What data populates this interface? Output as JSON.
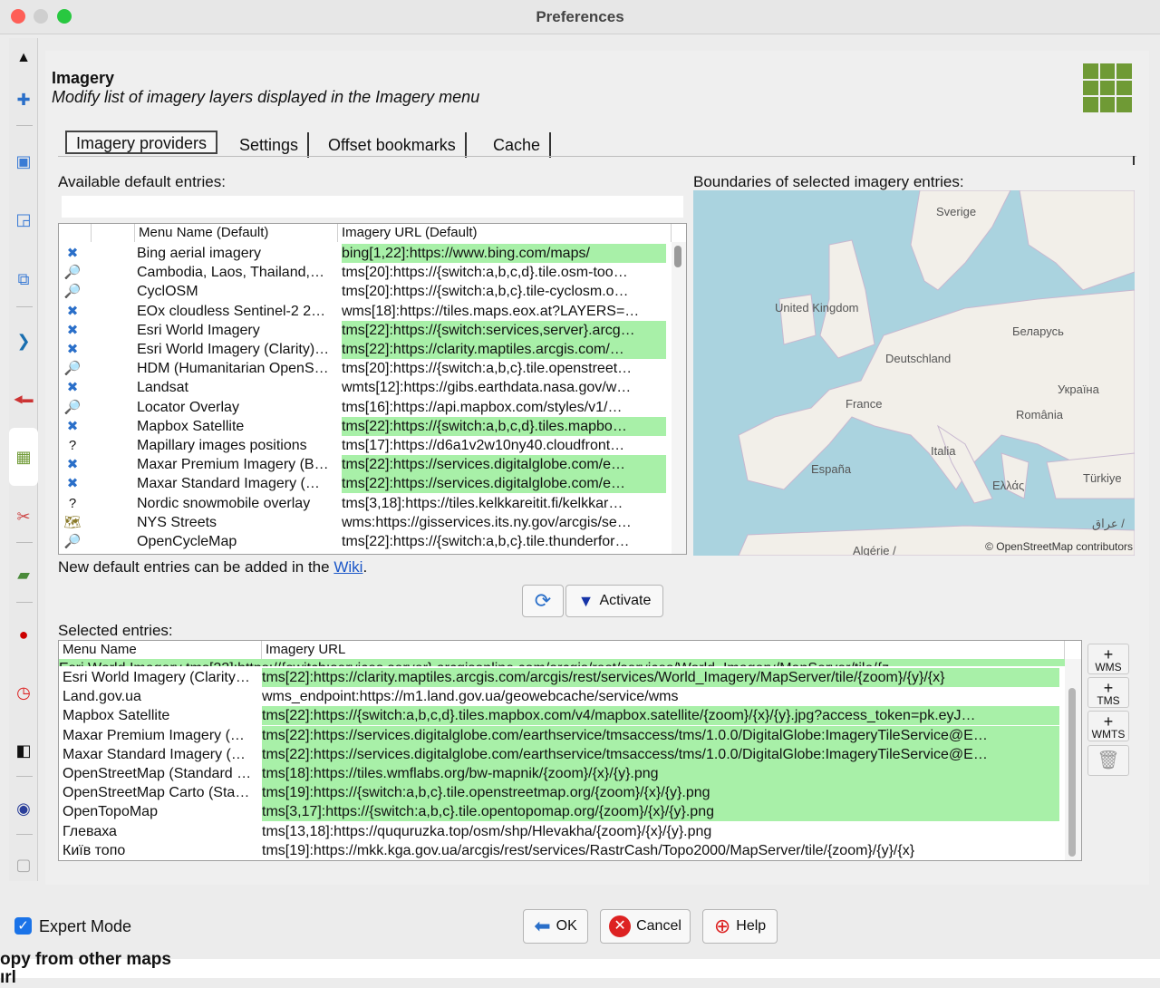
{
  "window": {
    "title": "Preferences"
  },
  "header": {
    "title": "Imagery",
    "subtitle": "Modify list of imagery layers displayed in the Imagery menu"
  },
  "tabs": [
    "Imagery providers",
    "Settings",
    "Offset bookmarks",
    "Cache"
  ],
  "available": {
    "label": "Available default entries:",
    "filter_value": "",
    "columns": [
      "Menu Name (Default)",
      "Imagery URL (Default)"
    ],
    "rows": [
      {
        "icon": "tms-icon",
        "name": "Bing aerial imagery",
        "url": "bing[1,22]:https://www.bing.com/maps/",
        "active": true
      },
      {
        "icon": "magnifier-icon",
        "name": "Cambodia, Laos, Thailand,…",
        "url": "tms[20]:https://{switch:a,b,c,d}.tile.osm-too…",
        "active": false
      },
      {
        "icon": "magnifier-icon",
        "name": "CyclOSM",
        "url": "tms[20]:https://{switch:a,b,c}.tile-cyclosm.o…",
        "active": false
      },
      {
        "icon": "tms-icon",
        "name": "EOx cloudless Sentinel-2 2…",
        "url": "wms[18]:https://tiles.maps.eox.at?LAYERS=…",
        "active": false
      },
      {
        "icon": "tms-icon",
        "name": "Esri World Imagery",
        "url": "tms[22]:https://{switch:services,server}.arcg…",
        "active": true
      },
      {
        "icon": "tms-icon",
        "name": "Esri World Imagery (Clarity)…",
        "url": "tms[22]:https://clarity.maptiles.arcgis.com/…",
        "active": true
      },
      {
        "icon": "magnifier-icon",
        "name": "HDM (Humanitarian OpenS…",
        "url": "tms[20]:https://{switch:a,b,c}.tile.openstreet…",
        "active": false
      },
      {
        "icon": "tms-icon",
        "name": "Landsat",
        "url": "wmts[12]:https://gibs.earthdata.nasa.gov/w…",
        "active": false
      },
      {
        "icon": "magnifier-icon",
        "name": "Locator Overlay",
        "url": "tms[16]:https://api.mapbox.com/styles/v1/…",
        "active": false
      },
      {
        "icon": "tms-icon",
        "name": "Mapbox Satellite",
        "url": "tms[22]:https://{switch:a,b,c,d}.tiles.mapbo…",
        "active": true
      },
      {
        "icon": "question-icon",
        "name": "Mapillary images positions",
        "url": "tms[17]:https://d6a1v2w10ny40.cloudfront…",
        "active": false
      },
      {
        "icon": "tms-icon",
        "name": "Maxar Premium Imagery (B…",
        "url": "tms[22]:https://services.digitalglobe.com/e…",
        "active": true
      },
      {
        "icon": "tms-icon",
        "name": "Maxar Standard Imagery (…",
        "url": "tms[22]:https://services.digitalglobe.com/e…",
        "active": true
      },
      {
        "icon": "question-icon",
        "name": "Nordic snowmobile overlay",
        "url": "tms[3,18]:https://tiles.kelkkareitit.fi/kelkkar…",
        "active": false
      },
      {
        "icon": "map-icon",
        "name": "NYS Streets",
        "url": "wms:https://gisservices.its.ny.gov/arcgis/se…",
        "active": false
      },
      {
        "icon": "magnifier-icon",
        "name": "OpenCycleMap",
        "url": "tms[22]:https://{switch:a,b,c}.tile.thunderfor…",
        "active": false
      }
    ],
    "note_prefix": "New default entries can be added in the ",
    "note_link": "Wiki",
    "note_suffix": "."
  },
  "map": {
    "label": "Boundaries of selected imagery entries:",
    "attribution": "© OpenStreetMap contributors",
    "places": [
      "Sverige",
      "United Kingdom",
      "Беларусь",
      "Deutschland",
      "France",
      "Україна",
      "România",
      "Italia",
      "España",
      "Ελλάς",
      "Türkiye",
      "Algérie /",
      "عراق /"
    ]
  },
  "actions": {
    "refresh_icon": "refresh-icon",
    "activate_label": "Activate"
  },
  "selected": {
    "label": "Selected entries:",
    "columns": [
      "Menu Name",
      "Imagery URL"
    ],
    "partial_row": "Esri World Imagery    tms[22]:https://{switch:services,server}.arcgisonline.com/arcgis/rest/services/World_Imagery/MapServer/tile/{z…",
    "rows": [
      {
        "name": "Esri World Imagery (Clarity…",
        "url": "tms[22]:https://clarity.maptiles.arcgis.com/arcgis/rest/services/World_Imagery/MapServer/tile/{zoom}/{y}/{x}",
        "active": true
      },
      {
        "name": "Land.gov.ua",
        "url": "wms_endpoint:https://m1.land.gov.ua/geowebcache/service/wms",
        "active": false
      },
      {
        "name": "Mapbox Satellite",
        "url": "tms[22]:https://{switch:a,b,c,d}.tiles.mapbox.com/v4/mapbox.satellite/{zoom}/{x}/{y}.jpg?access_token=pk.eyJ…",
        "active": true
      },
      {
        "name": "Maxar Premium Imagery (…",
        "url": "tms[22]:https://services.digitalglobe.com/earthservice/tmsaccess/tms/1.0.0/DigitalGlobe:ImageryTileService@E…",
        "active": true
      },
      {
        "name": "Maxar Standard Imagery (…",
        "url": "tms[22]:https://services.digitalglobe.com/earthservice/tmsaccess/tms/1.0.0/DigitalGlobe:ImageryTileService@E…",
        "active": true
      },
      {
        "name": "OpenStreetMap (Standard …",
        "url": "tms[18]:https://tiles.wmflabs.org/bw-mapnik/{zoom}/{x}/{y}.png",
        "active": true
      },
      {
        "name": "OpenStreetMap Carto (Sta…",
        "url": "tms[19]:https://{switch:a,b,c}.tile.openstreetmap.org/{zoom}/{x}/{y}.png",
        "active": true
      },
      {
        "name": "OpenTopoMap",
        "url": "tms[3,17]:https://{switch:a,b,c}.tile.opentopomap.org/{zoom}/{x}/{y}.png",
        "active": true
      },
      {
        "name": "Глеваха",
        "url": "tms[13,18]:https://ququruzka.top/osm/shp/Hlevakha/{zoom}/{x}/{y}.png",
        "active": false
      },
      {
        "name": "Київ топо",
        "url": "tms[19]:https://mkk.kga.gov.ua/arcgis/rest/services/RastrCash/Topo2000/MapServer/tile/{zoom}/{y}/{x}",
        "active": false
      }
    ],
    "side_buttons": [
      "WMS",
      "TMS",
      "WMTS"
    ]
  },
  "footer": {
    "expert_mode_label": "Expert Mode",
    "expert_mode_checked": true,
    "ok_label": "OK",
    "cancel_label": "Cancel",
    "help_label": "Help",
    "background_text_1": "opy from other maps",
    "background_text_2": "ırl"
  },
  "colors": {
    "active_row": "#a8f0a8",
    "accent": "#1a73e8",
    "grid_icon": "#6f9a35"
  }
}
